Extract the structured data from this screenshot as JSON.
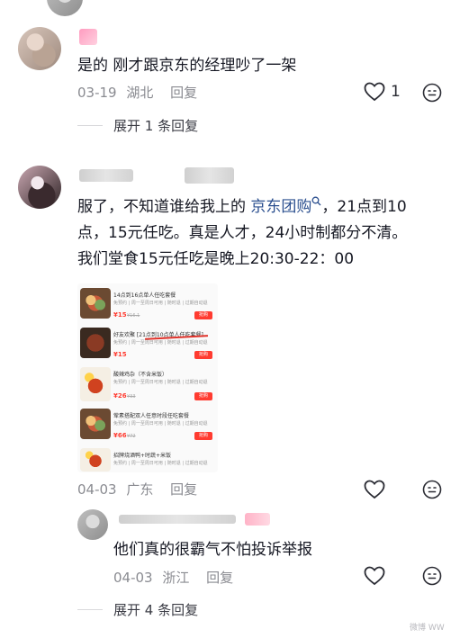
{
  "comments": [
    {
      "text": "是的 刚才跟京东的经理吵了一架",
      "date": "03-19",
      "location": "湖北",
      "reply_label": "回复",
      "like_count": "1",
      "expand_label": "展开 1 条回复"
    },
    {
      "text_before": "服了，不知道谁给我上的 ",
      "link": "京东团购",
      "text_after_line1": "，21点到10",
      "text_line2": "点，15元任吃。真是人才，24小时制都分不清。",
      "text_line3": "我们堂食15元任吃是晚上20:30-22：00",
      "date": "04-03",
      "location": "广东",
      "reply_label": "回复"
    }
  ],
  "reply": {
    "text": "他们真的很霸气不怕投诉举报",
    "date": "04-03",
    "location": "浙江",
    "reply_label": "回复"
  },
  "expand_2": "展开 4 条回复",
  "screenshot_products": [
    {
      "title": "14点到16点单人任吃套餐",
      "sub": "免预约 | 周一至周日可用 | 随时退 | 过期自动退",
      "price": "¥15",
      "old": "¥16.1",
      "buy": "抢购"
    },
    {
      "title": "好友欢聚 [21点到10点单人任吃套餐]",
      "sub": "免预约 | 周一至周日可用 | 随时退 | 过期自动退",
      "price": "¥15",
      "old": "",
      "buy": "抢购"
    },
    {
      "title": "酸辣鸡杂（不含米饭）",
      "sub": "免预约 | 周一至周日可用 | 随时退 | 过期自动退",
      "price": "¥26",
      "old": "¥33",
      "buy": "抢购"
    },
    {
      "title": "荤素搭配双人任意时段任吃套餐",
      "sub": "免预约 | 周一至周日可用 | 随时退 | 过期自动退",
      "price": "¥66",
      "old": "¥72",
      "buy": "抢购"
    },
    {
      "title": "招牌烧酒鸭+时蔬+米饭",
      "sub": "免预约 | 周一至周日可用 | 随时退 | 过期自动退",
      "price": "",
      "old": "",
      "buy": ""
    }
  ],
  "watermark": "微博 WW"
}
